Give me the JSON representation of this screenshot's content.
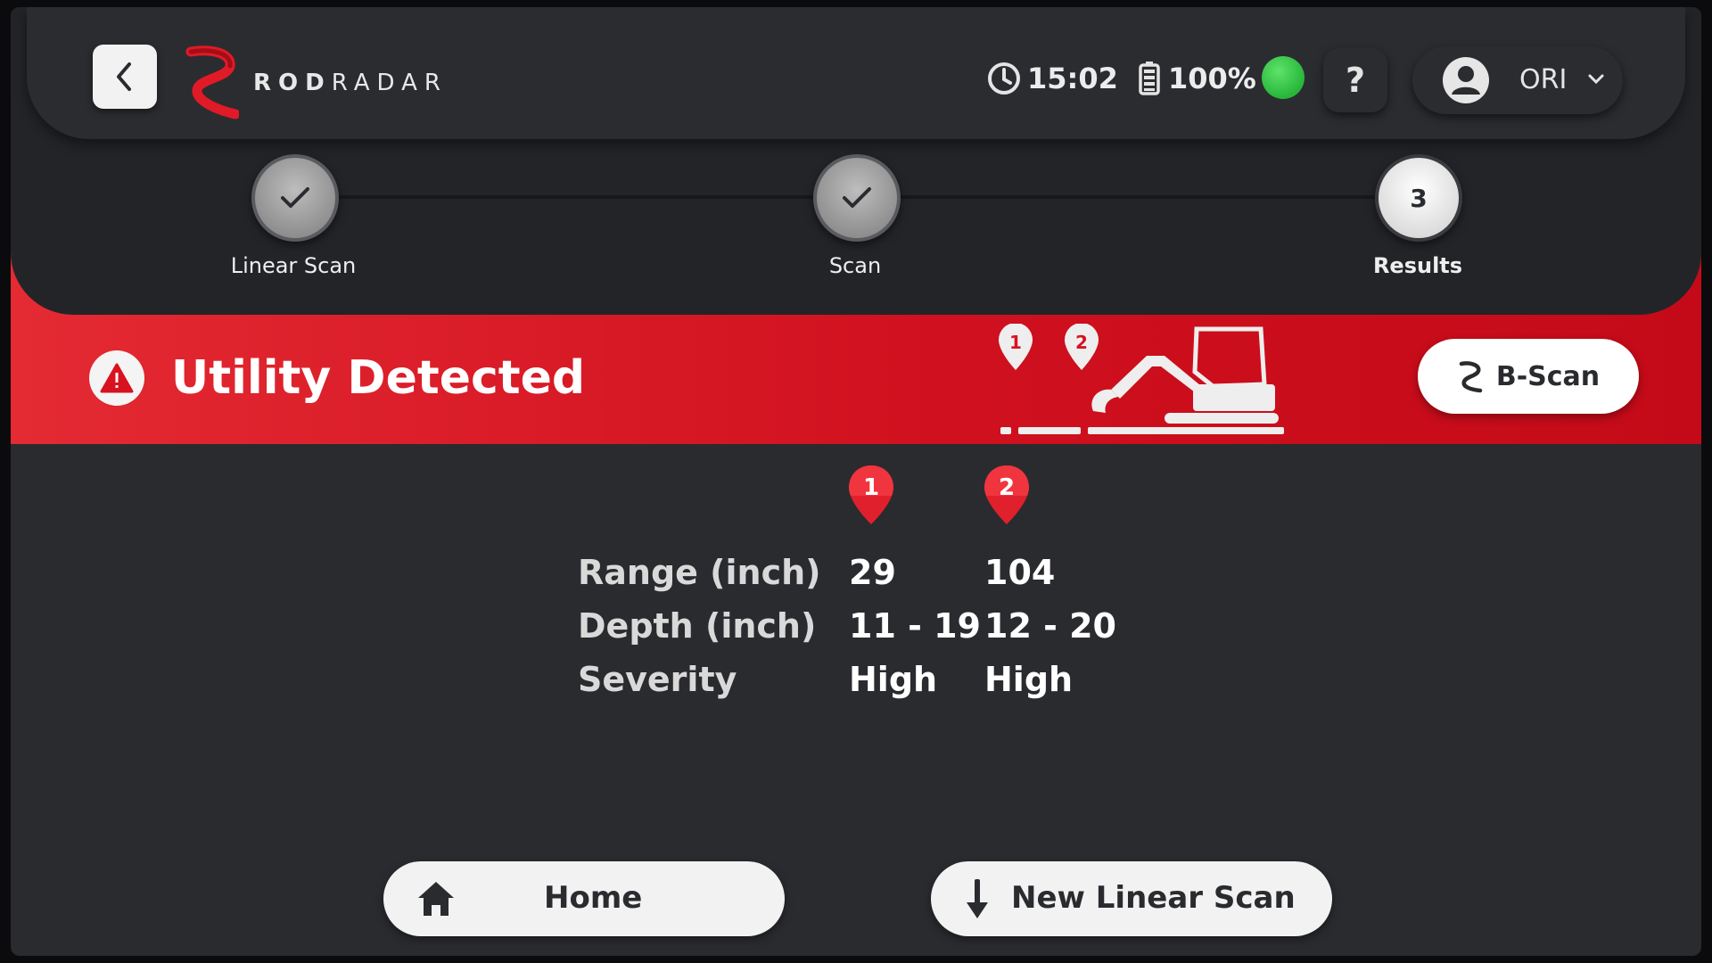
{
  "header": {
    "brand_bold": "ROD",
    "brand_light": "RADAR",
    "time": "15:02",
    "battery": "100%",
    "connection_color": "#2fbf3e",
    "help_label": "?",
    "user_name": "ORI"
  },
  "stepper": {
    "steps": [
      {
        "label": "Linear Scan",
        "state": "done"
      },
      {
        "label": "Scan",
        "state": "done"
      },
      {
        "label": "Results",
        "state": "current",
        "number": "3"
      }
    ]
  },
  "alert": {
    "title": "Utility Detected",
    "markers": [
      "1",
      "2"
    ],
    "bscan_label": "B-Scan",
    "accent": "#d8121f"
  },
  "results": {
    "markers": [
      "1",
      "2"
    ],
    "rows": [
      {
        "label": "Range (inch)",
        "values": [
          "29",
          "104"
        ]
      },
      {
        "label": "Depth (inch)",
        "values": [
          "11 - 19",
          "12 - 20"
        ]
      },
      {
        "label": "Severity",
        "values": [
          "High",
          "High"
        ]
      }
    ]
  },
  "actions": {
    "home": "Home",
    "new_linear_scan": "New Linear Scan"
  }
}
